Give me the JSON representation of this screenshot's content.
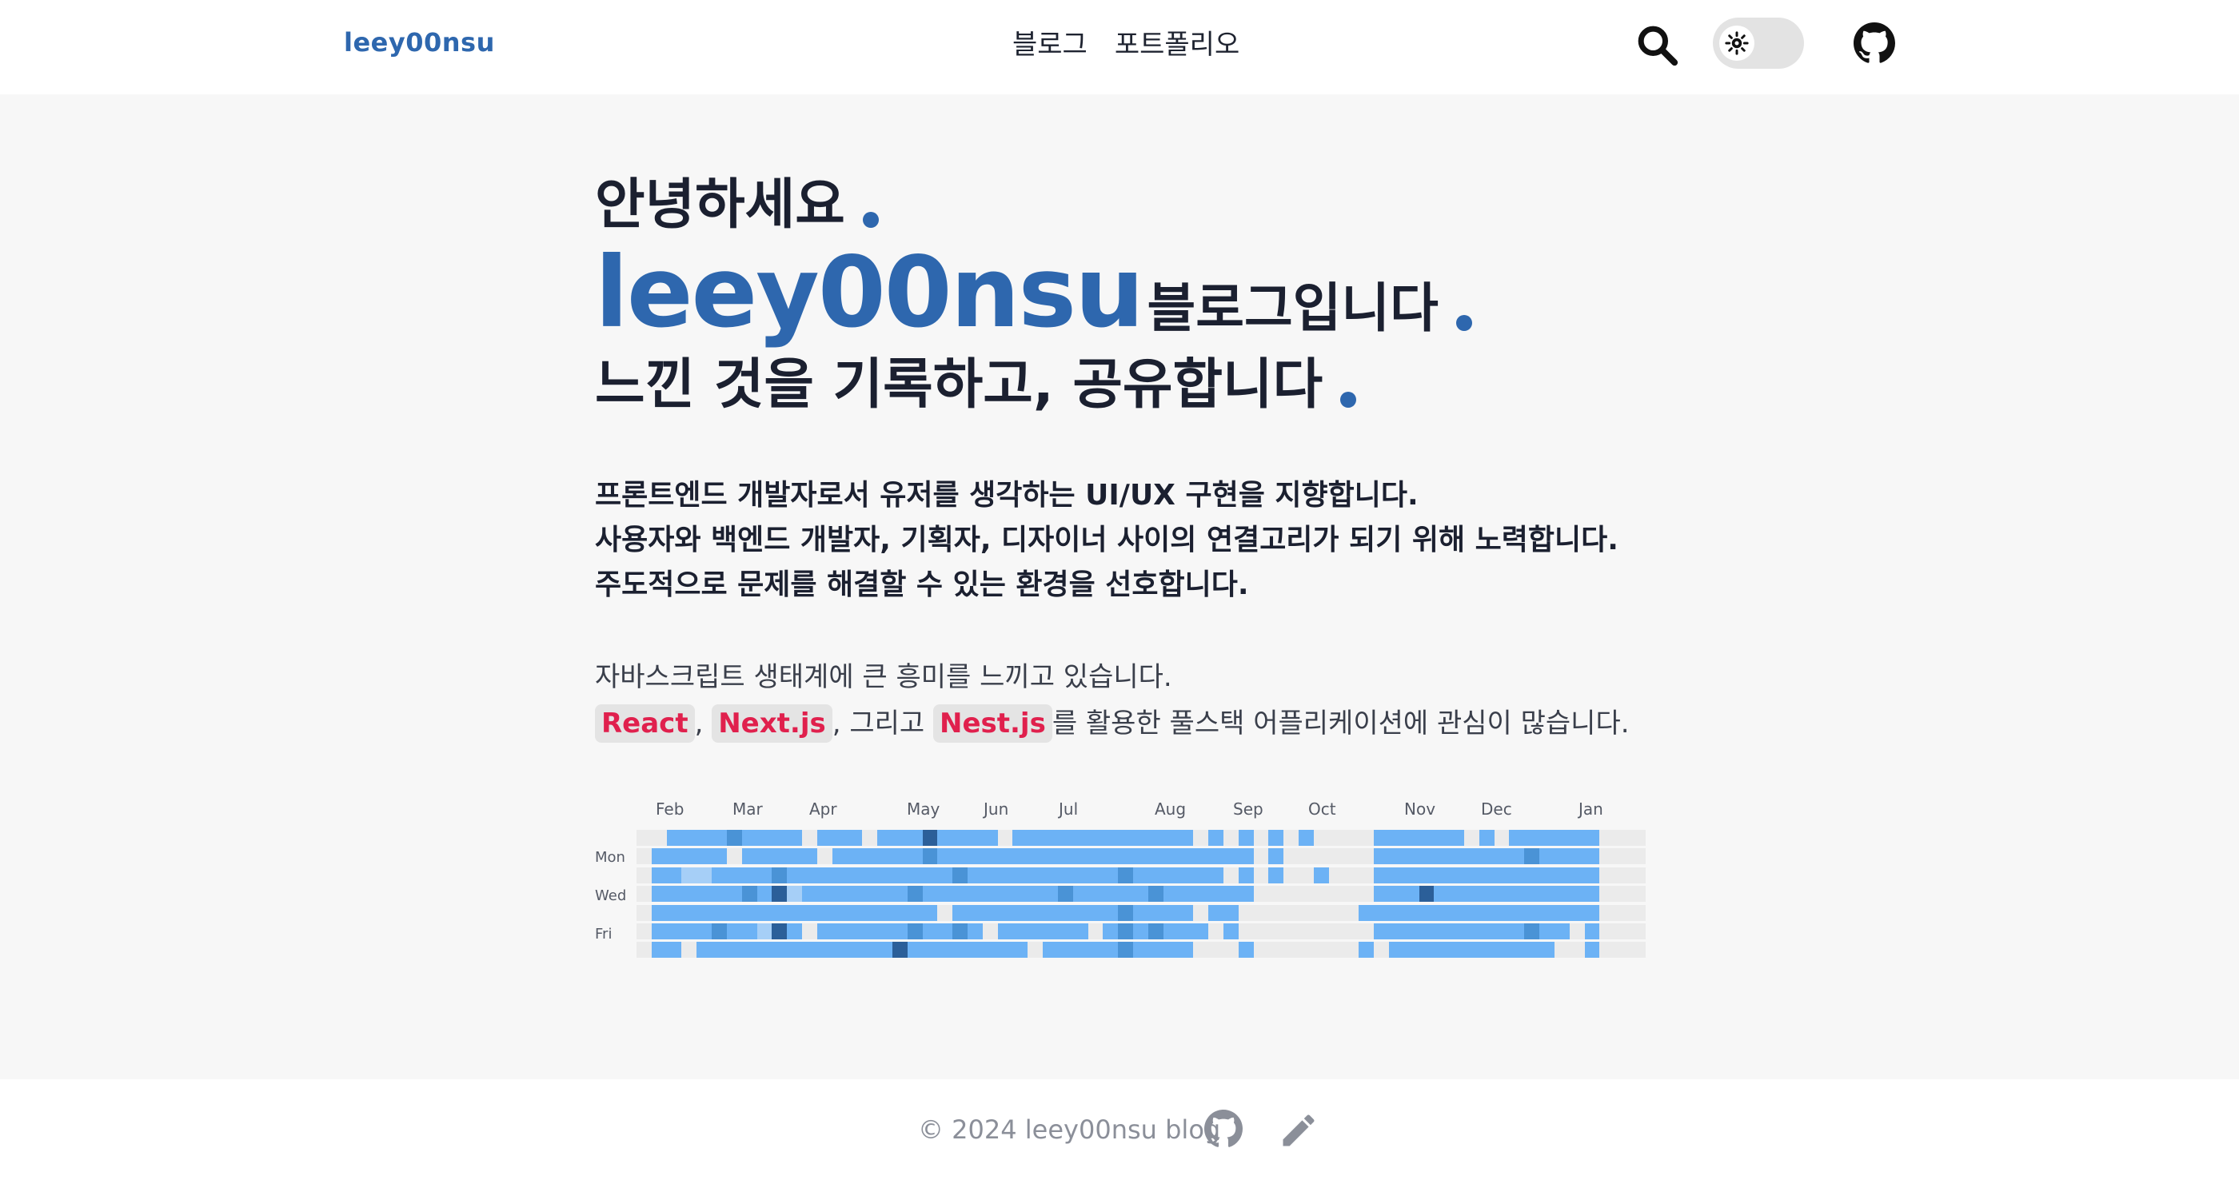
{
  "header": {
    "logo": "leey00nsu",
    "nav": [
      "블로그",
      "포트폴리오"
    ],
    "icons": {
      "search": "search-icon",
      "theme": "sun-icon",
      "repo": "github-icon"
    }
  },
  "hero": {
    "greeting": "안녕하세요",
    "brand": "leey00nsu",
    "brand_suffix": "블로그입니다",
    "tagline": "느낀 것을 기록하고, 공유합니다"
  },
  "intro": [
    "프론트엔드 개발자로서 유저를 생각하는 UI/UX 구현을 지향합니다.",
    "사용자와 백엔드 개발자, 기획자, 디자이너 사이의 연결고리가 되기 위해 노력합니다.",
    "주도적으로 문제를 해결할 수 있는 환경을 선호합니다."
  ],
  "interests": {
    "line1": "자바스크립트 생태계에 큰 흥미를 느끼고 있습니다.",
    "tech": [
      "React",
      "Next.js",
      "Nest.js"
    ],
    "sep1": ", ",
    "sep2": ", 그리고 ",
    "tail": "를 활용한 풀스택 어플리케이션에 관심이 많습니다."
  },
  "contributions": {
    "months": [
      "Feb",
      "Mar",
      "Apr",
      "May",
      "Jun",
      "Jul",
      "Aug",
      "Sep",
      "Oct",
      "Nov",
      "Dec",
      "Jan"
    ],
    "days": [
      "Mon",
      "Wed",
      "Fri"
    ],
    "palette": [
      "#ebebeb",
      "#a6cff7",
      "#6cb2f5",
      "#4a93d6",
      "#2b5f99"
    ],
    "levels": [
      "0000000",
      "0222222",
      "2222222",
      "2212220",
      "2212222",
      "2222232",
      "3022222",
      "2223222",
      "2222212",
      "2234242",
      "2221222",
      "0222202",
      "2022222",
      "2222222",
      "2222222",
      "0222222",
      "2222222",
      "2222224",
      "2223232",
      "4322222",
      "2222022",
      "2232232",
      "2222222",
      "2222202",
      "0222222",
      "2222222",
      "2222220",
      "2222222",
      "2223222",
      "2222222",
      "2222202",
      "2222222",
      "2232333",
      "2222222",
      "2223232",
      "2222222",
      "2222222",
      "0222020",
      "2222200",
      "0202220",
      "2222002",
      "0000000",
      "2220000",
      "0000000",
      "2000000",
      "0020000",
      "0000000",
      "0000000",
      "0000202",
      "2222220",
      "2222222",
      "2222222",
      "2224222",
      "2222222",
      "2222222",
      "0222222",
      "2222222",
      "0222222",
      "2222222",
      "2322232",
      "2222222",
      "2222220",
      "2222200",
      "2222222",
      "0000000",
      "0000000",
      "0000000"
    ]
  },
  "footer": {
    "copyright": "© 2024 leey00nsu blog",
    "icons": {
      "repo": "github-icon",
      "edit": "pencil-icon"
    }
  }
}
